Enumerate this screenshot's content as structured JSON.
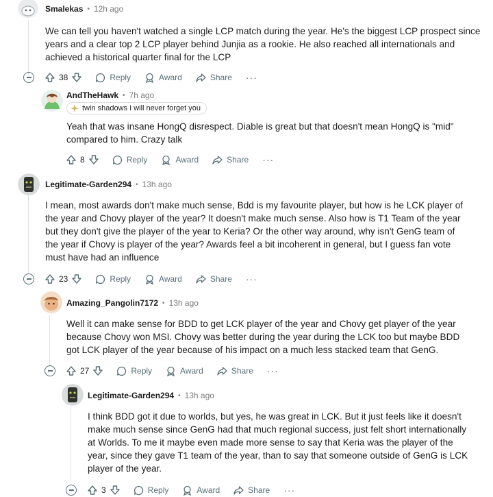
{
  "comments": [
    {
      "author": "Smalekas",
      "time": "12h ago",
      "text": "We can tell you haven't watched a single LCP match during the year. He's the biggest LCP prospect since years and a clear top 2 LCP player behind Junjia as a rookie. He also reached all internationals and achieved a historical quarter final for the LCP",
      "votes": "38",
      "reply": "Reply",
      "award": "Award",
      "share": "Share",
      "more": "···"
    },
    {
      "author": "AndTheHawk",
      "time": "7h ago",
      "flair": "twin shadows I will never forget you",
      "text": "Yeah that was insane HongQ disrespect. Diable is great but that doesn't mean HongQ is \"mid\" compared to him. Crazy talk",
      "votes": "8",
      "reply": "Reply",
      "award": "Award",
      "share": "Share",
      "more": "···"
    },
    {
      "author": "Legitimate-Garden294",
      "time": "13h ago",
      "text": "I mean, most awards don't make much sense, Bdd is my favourite player, but how is he LCK player of the year and Chovy player of the year? It doesn't make much sense. Also how is T1 Team of the year but they don't give the player of the year to Keria? Or the other way around, why isn't GenG team of the year if Chovy is player of the year? Awards feel a bit incoherent in general, but I guess fan vote must have had an influence",
      "votes": "23",
      "reply": "Reply",
      "award": "Award",
      "share": "Share",
      "more": "···"
    },
    {
      "author": "Amazing_Pangolin7172",
      "time": "13h ago",
      "text": "Well it can make sense for BDD to get LCK player of the year and Chovy get player of the year because Chovy won MSI. Chovy was better during the year during the LCK too but maybe BDD got LCK player of the year because of his impact on a much less stacked team that GenG.",
      "votes": "27",
      "reply": "Reply",
      "award": "Award",
      "share": "Share",
      "more": "···"
    },
    {
      "author": "Legitimate-Garden294",
      "time": "13h ago",
      "text": "I think BDD got it due to worlds, but yes, he was great in LCK. But it just feels like it doesn't make much sense since GenG had that much regional success, just felt short internationally at Worlds. To me it maybe even made more sense to say that Keria was the player of the year, since they gave T1 team of the year, than to say that someone outside of GenG is LCK player of the year.",
      "votes": "3",
      "reply": "Reply",
      "award": "Award",
      "share": "Share",
      "more": "···"
    }
  ],
  "separator": "•"
}
